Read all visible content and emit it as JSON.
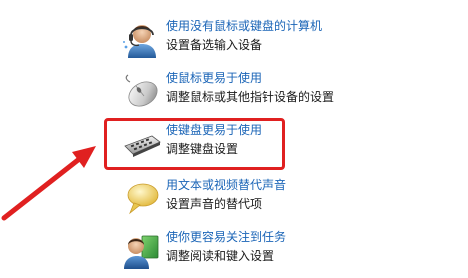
{
  "items": [
    {
      "title": "使用没有鼠标或键盘的计算机",
      "desc": "设置备选输入设备",
      "icon": "user-with-headset-icon"
    },
    {
      "title": "使鼠标更易于使用",
      "desc": "调整鼠标或其他指针设备的设置",
      "icon": "mouse-icon"
    },
    {
      "title": "使键盘更易于使用",
      "desc": "调整键盘设置",
      "icon": "keyboard-icon"
    },
    {
      "title": "用文本或视频替代声音",
      "desc": "设置声音的替代项",
      "icon": "speech-bubble-icon"
    },
    {
      "title": "使你更容易关注到任务",
      "desc": "调整阅读和键入设置",
      "icon": "user-with-document-icon"
    }
  ],
  "colors": {
    "link": "#1b65b7",
    "annotation": "#e02020"
  }
}
